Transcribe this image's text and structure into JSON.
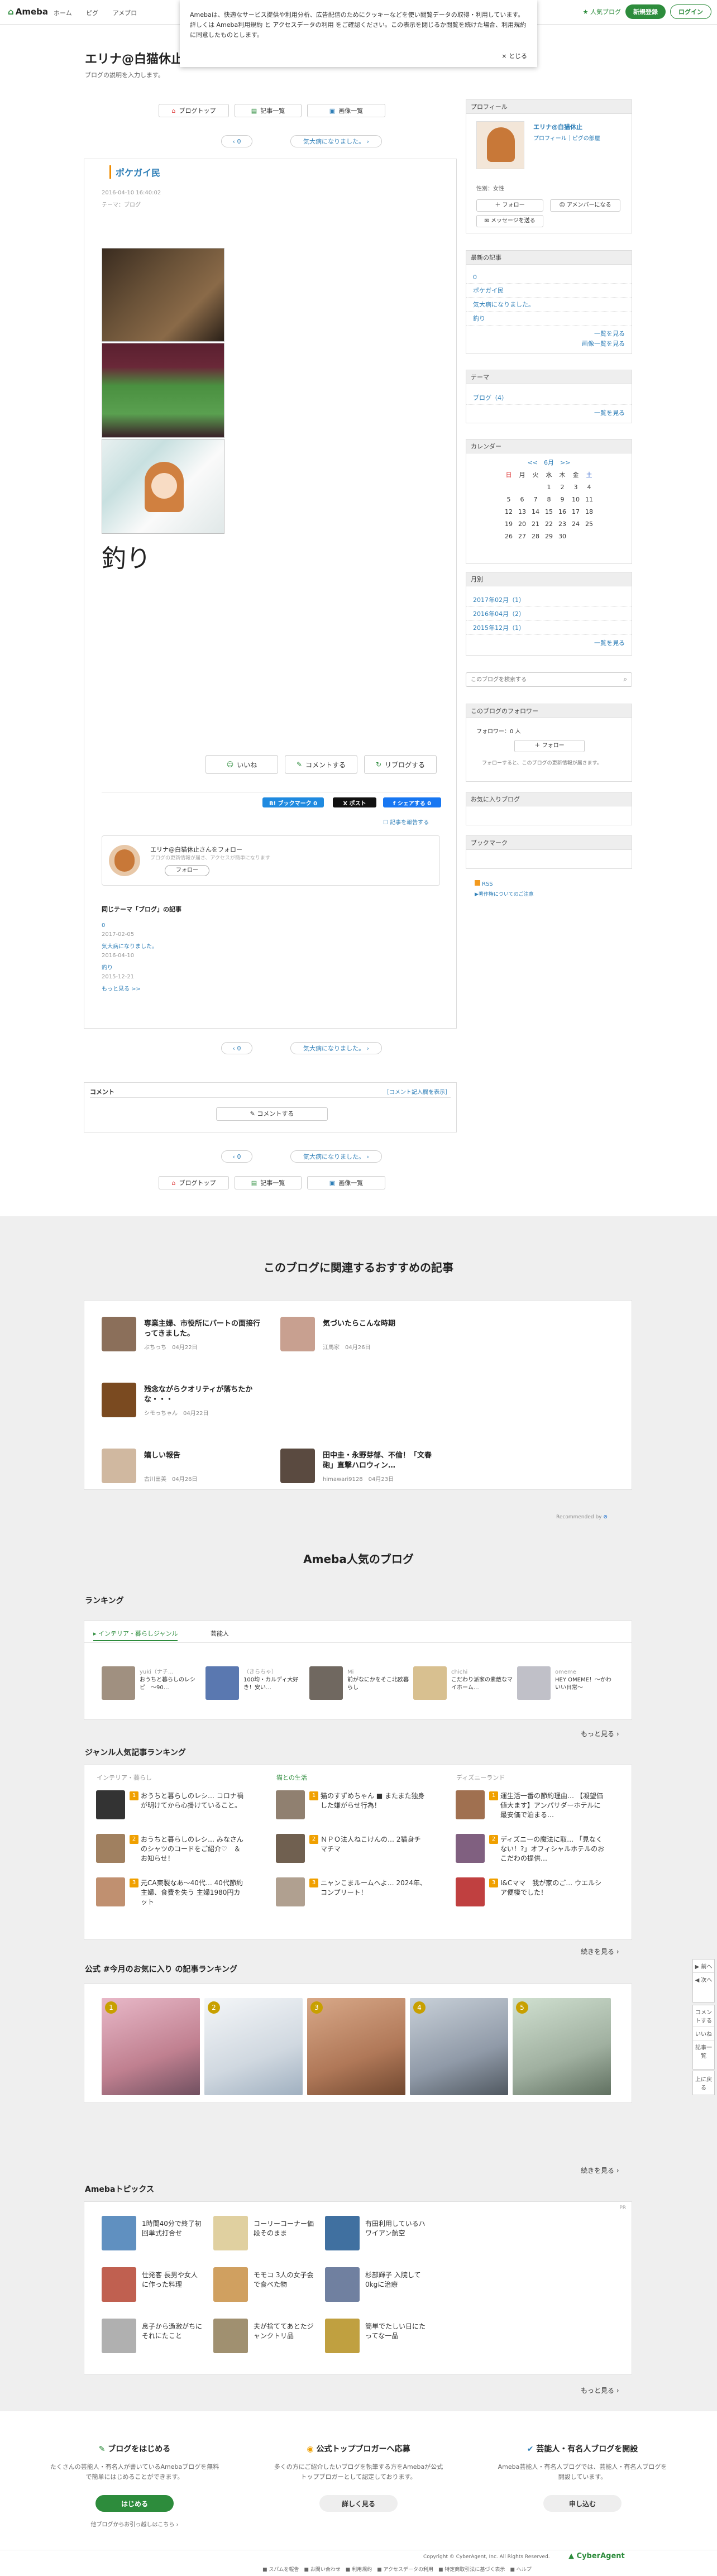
{
  "header": {
    "logo": "Ameba",
    "crumbs": [
      "ホーム",
      "ピグ",
      "アメブロ"
    ],
    "blog_button": "人気ブログ",
    "signup": "新規登録",
    "login": "ログイン"
  },
  "cookie": {
    "text": "Amebaは、快適なサービス提供や利用分析、広告配信のためにクッキーなどを使い閲覧データの取得・利用しています。詳しくは Ameba利用規約 と アクセスデータの利用 をご確認ください。この表示を閉じるか閲覧を続けた場合、利用規約に同意したものとします。",
    "close": "× とじる"
  },
  "blog": {
    "title": "エリナ@白猫休止中",
    "desc": "ブログの説明を入力します。",
    "nav_top": "ブログトップ",
    "nav_list": "記事一覧",
    "nav_images": "画像一覧"
  },
  "pager": {
    "prev": "‹ 0",
    "next": "気大病になりました。 ›"
  },
  "article": {
    "title": "ポケガイ民",
    "date": "2016-04-10 16:40:02",
    "theme": "テーマ：ブログ",
    "big_text": "釣り",
    "like": "いいね",
    "comment": "コメントする",
    "reblog": "リブログする",
    "share_b": "B! ブックマーク 0",
    "share_x": "X ポスト",
    "share_f": "f シェアする 0",
    "report": "記事を報告する",
    "follow_name": "エリナ@白猫休止さんをフォロー",
    "follow_sub": "ブログの更新情報が届き、アクセスが簡単になります",
    "follow_btn": "フォロー",
    "same_theme": "同じテーマ「ブログ」の記事",
    "same_items": [
      {
        "title": "0",
        "date": "2017-02-05"
      },
      {
        "title": "気大病になりました。",
        "date": "2016-04-10"
      },
      {
        "title": "釣り",
        "date": "2015-12-21"
      }
    ],
    "same_more": "もっと見る >>"
  },
  "comments": {
    "label": "コメント",
    "rules": "［コメント記入欄を表示］",
    "button": "コメントする"
  },
  "sidebar": {
    "profile": "プロフィール",
    "profile_name": "エリナ@白猫休止",
    "profile_links": "プロフィール｜ピグの部屋",
    "gender": "性別：女性",
    "follow": "フォロー",
    "amember": "アメンバーになる",
    "message": "メッセージを送る",
    "recent": "最新の記事",
    "recent_items": [
      "0",
      "ポケガイ民",
      "気大病になりました。",
      "釣り"
    ],
    "list_more": "一覧を見る",
    "image_list": "画像一覧を見る",
    "theme": "テーマ",
    "theme_items": [
      "ブログ（4）"
    ],
    "calendar": "カレンダー",
    "cal_month": "<<　6月　>>",
    "cal_days": [
      "日",
      "月",
      "火",
      "水",
      "木",
      "金",
      "土"
    ],
    "cal_rows": [
      [
        "",
        "",
        "",
        "1",
        "2",
        "3",
        "4"
      ],
      [
        "5",
        "6",
        "7",
        "8",
        "9",
        "10",
        "11"
      ],
      [
        "12",
        "13",
        "14",
        "15",
        "16",
        "17",
        "18"
      ],
      [
        "19",
        "20",
        "21",
        "22",
        "23",
        "24",
        "25"
      ],
      [
        "26",
        "27",
        "28",
        "29",
        "30",
        "",
        ""
      ]
    ],
    "archive": "月別",
    "archive_items": [
      "2017年02月（1）",
      "2016年04月（2）",
      "2015年12月（1）"
    ],
    "search_placeholder": "このブログを検索する",
    "followers": "このブログのフォロワー",
    "followers_count": "フォロワー：0 人",
    "followers_btn": "フォロー",
    "followers_note": "フォローすると、このブログの更新情報が届きます。",
    "favorites": "お気に入りブログ",
    "bookmarks": "ブックマーク",
    "rss": "RSS",
    "rss_note": "▶著作権についてのご注意"
  },
  "related": {
    "heading": "このブログに関連するおすすめの記事",
    "items": [
      {
        "title": "専業主婦、市役所にパートの面接行ってきました。",
        "author": "ぶちっち",
        "date": "04月22日",
        "color": "#8b6f5a"
      },
      {
        "title": "気づいたらこんな時期",
        "author": "江馬家",
        "date": "04月26日",
        "color": "#c8a090"
      },
      {
        "title": "残念ながらクオリティが落ちたかな・・・",
        "author": "シモっちゃん",
        "date": "04月22日",
        "color": "#7a4a20"
      },
      {
        "title": "嬉しい報告",
        "author": "古川出美",
        "date": "04月26日",
        "color": "#d0b8a0"
      },
      {
        "title": "田中圭・永野芽郁、不倫！「文春砲」直撃ハロウィン…",
        "author": "himawari9128",
        "date": "04月23日",
        "color": "#5a4a40"
      }
    ],
    "credit": "Recommended by"
  },
  "popular": {
    "heading": "Ameba人気のブログ",
    "ranking": "ランキング",
    "tabs": [
      "インテリア・暮らしジャンル",
      "芸能人"
    ],
    "rank_items": [
      {
        "author": "yuki（ナチ…",
        "title": "おうちと暮らしのレシピ　〜90…",
        "color": "#a09080"
      },
      {
        "author": "（きらちゃ）",
        "title": "100均・カルディ大好き！安い…",
        "color": "#5a78b0"
      },
      {
        "author": "Mi",
        "title": "前がなにかをそこ北欧暮らし",
        "color": "#706860"
      },
      {
        "author": "chichi",
        "title": "こだわり派家の素敵なマイホーム…",
        "color": "#d8c090"
      },
      {
        "author": "omeme",
        "title": "HEY OMEME！〜かわいい日常〜",
        "color": "#c0c0c8"
      }
    ],
    "more": "もっと見る",
    "genre": "ジャンル人気記事ランキング",
    "genre_cols": [
      "インテリア・暮らし",
      "猫との生活",
      "ディズニーランド"
    ],
    "genre_items": [
      [
        {
          "t": "おうちと暮らしのレシ… コロナ禍が明けてから心掛けていること。",
          "c": "#333"
        },
        {
          "t": "おうちと暮らしのレシ… みなさんのシャツのコードをご紹介♡　＆お知らせ！",
          "c": "#a08060"
        },
        {
          "t": "元CA東製なあ〜40代… 40代節約主婦、食費を失う 主婦1980円カット",
          "c": "#c09070"
        }
      ],
      [
        {
          "t": "猫のすずめちゃん ■ またまた独身した嫌がらせ行為！",
          "c": "#908070"
        },
        {
          "t": "ＮＰＯ法人ねこけんの… 2猫身チマチマ",
          "c": "#706050"
        },
        {
          "t": "ニャンこまルームへよ… 2024年、コンプリート！",
          "c": "#b0a090"
        }
      ],
      [
        {
          "t": "運生活一番の節約理由… 【凝望価値大ます】アンパサダーホテルに最安価で泊まる…",
          "c": "#a07050"
        },
        {
          "t": "ディズニーの魔法に取… 「見なくない！?」オフィシャルホテルのおこだわの提供…",
          "c": "#806080"
        },
        {
          "t": "I&Cママ　我が家のご… ウエルシア便棲でした！",
          "c": "#c04040"
        }
      ]
    ],
    "genre_more": "続きを見る",
    "official": "公式 #今月のお気に入り の記事ランキング",
    "official_colors": [
      "#c08090",
      "#d0d8e0",
      "#b07858",
      "#909aa8",
      "#a0b0a0"
    ],
    "official_more": "続きを見る"
  },
  "topics": {
    "heading": "Amebaトピックス",
    "pr": "PR",
    "items": [
      {
        "t": "1時間40分で終了初回単式打合せ",
        "c": "#6090c0"
      },
      {
        "t": "コーリーコーナー価段そのまま",
        "c": "#e0d0a0"
      },
      {
        "t": "有田利用しているハワイアン航空",
        "c": "#4070a0"
      },
      {
        "t": "仕発客 長男や女人に作った料理",
        "c": "#c06050"
      },
      {
        "t": "モモコ 3人の女子会で食べた物",
        "c": "#d0a060"
      },
      {
        "t": "杉部輝子 入院して0kgに治療",
        "c": "#7080a0"
      },
      {
        "t": "息子から過激がちにそれにたこと",
        "c": "#b0b0b0"
      },
      {
        "t": "夫が捨ててあとたジャンクトリ品",
        "c": "#a09070"
      },
      {
        "t": "簡単でたしい日にたってな一品",
        "c": "#c0a040"
      }
    ],
    "more": "もっと見る"
  },
  "footer": {
    "c1_h": "ブログをはじめる",
    "c1_d": "たくさんの芸能人・有名人が書いているAmebaブログを無料で簡単にはじめることができます。",
    "c1_b": "はじめる",
    "c1_l": "他ブログからお引っ越しはこちら",
    "c2_h": "公式トップブロガーへ応募",
    "c2_d": "多くの方にご紹介したいブログを執筆する方をAmebaが公式トップブロガーとして認定しております。",
    "c2_b": "詳しく見る",
    "c3_h": "芸能人・有名人ブログを開設",
    "c3_d": "Ameba芸能人・有名人ブログでは、芸能人・有名人ブログを開設しています。",
    "c3_b": "申し込む",
    "copyright": "Copyright © CyberAgent, Inc. All Rights Reserved.",
    "company": "CyberAgent",
    "links": "■ スパムを報告　■ お問い合わせ　■ 利用規約　■ アクセスデータの利用　■ 特定商取引法に基づく表示　■ ヘルプ"
  },
  "rail": [
    "▶ 前へ",
    "◀ 次へ",
    "コメントする",
    "いいね",
    "記事一覧",
    "上に戻る"
  ]
}
